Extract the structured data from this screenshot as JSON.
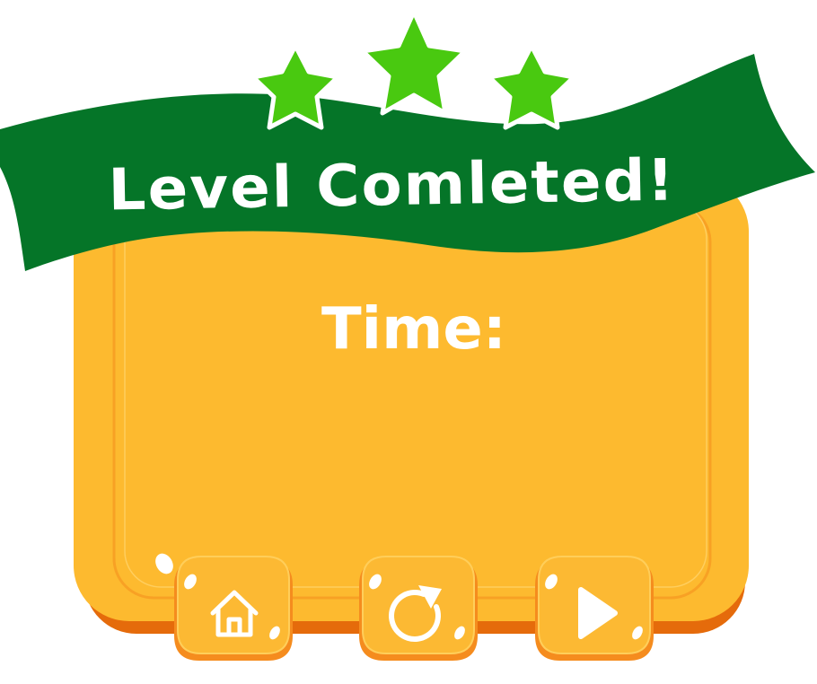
{
  "title": "Level Comleted!",
  "time_label": "Time:",
  "stars_earned": 3,
  "stars_total": 3,
  "buttons": [
    {
      "id": "home",
      "icon": "home-icon"
    },
    {
      "id": "restart",
      "icon": "restart-icon"
    },
    {
      "id": "next",
      "icon": "play-icon"
    }
  ],
  "colors": {
    "panel": "#FDBA2F",
    "panel_shadow": "#E36A0A",
    "ribbon": "#057528",
    "star": "#49C910",
    "button": "#FCB933"
  }
}
